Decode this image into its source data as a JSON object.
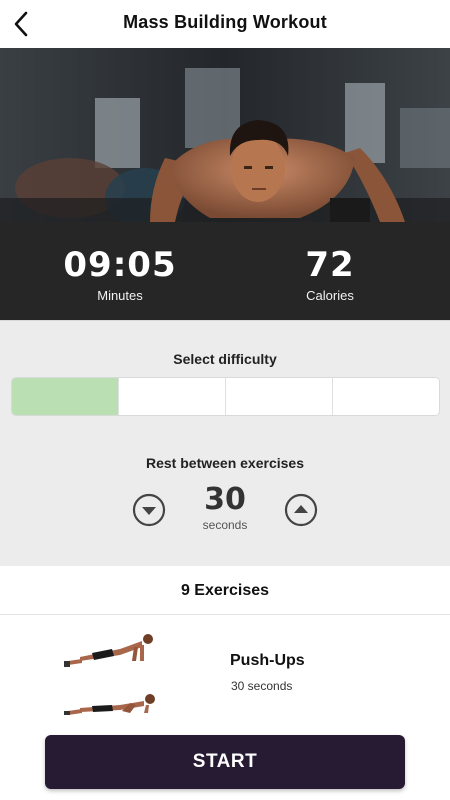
{
  "header": {
    "title": "Mass Building Workout",
    "back_icon": "chevron-left-icon"
  },
  "hero": {
    "image": "man-doing-push-up-photo"
  },
  "stats": {
    "minutes_value": "09:05",
    "minutes_label": "Minutes",
    "calories_value": "72",
    "calories_label": "Calories"
  },
  "difficulty": {
    "title": "Select difficulty",
    "levels": 4,
    "selected": 1,
    "selected_color": "#b9dfb3"
  },
  "rest": {
    "title": "Rest between exercises",
    "value": "30",
    "unit": "seconds",
    "decrease_icon": "chevron-down-circle-icon",
    "increase_icon": "chevron-up-circle-icon"
  },
  "exercises": {
    "count_label": "9 Exercises",
    "items": [
      {
        "name": "Push-Ups",
        "duration": "30 seconds",
        "thumbnail": "push-up-illustration"
      }
    ]
  },
  "actions": {
    "start_label": "START"
  },
  "colors": {
    "stats_background": "#262626",
    "panel_background": "#ececec",
    "start_button": "#271a33"
  }
}
